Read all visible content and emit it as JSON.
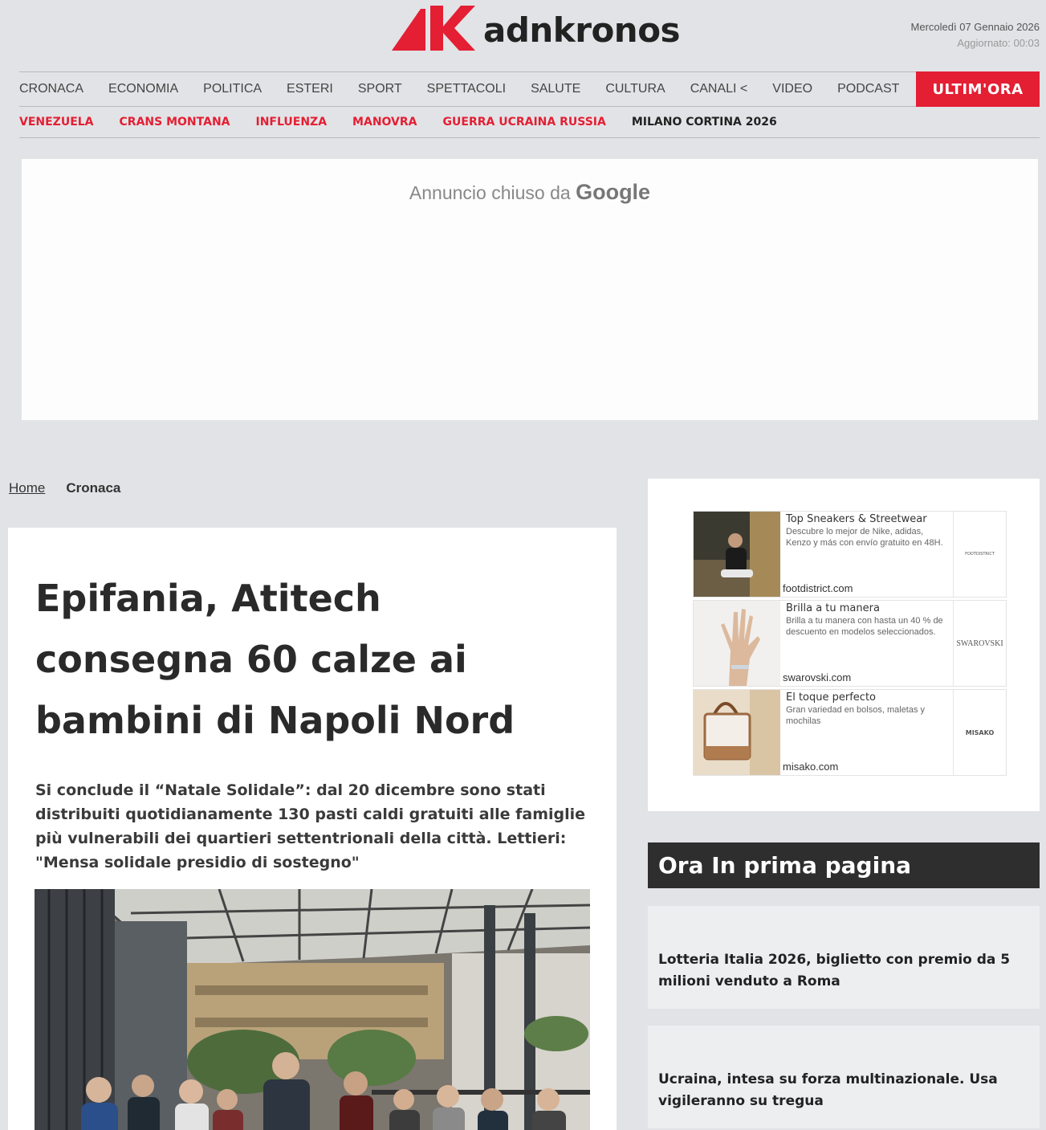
{
  "header": {
    "logo_text": "adnkronos",
    "date": "Mercoledì 07 Gennaio 2026",
    "updated": "Aggiornato: 00:03"
  },
  "nav": {
    "items": [
      "CRONACA",
      "ECONOMIA",
      "POLITICA",
      "ESTERI",
      "SPORT",
      "SPETTACOLI",
      "SALUTE",
      "CULTURA",
      "CANALI <",
      "VIDEO",
      "PODCAST"
    ],
    "ultim_ora": "ULTIM'ORA"
  },
  "topics": [
    "VENEZUELA",
    "CRANS MONTANA",
    "INFLUENZA",
    "MANOVRA",
    "GUERRA UCRAINA RUSSIA",
    "MILANO CORTINA 2026"
  ],
  "ad_top": {
    "closed_text": "Annuncio chiuso da",
    "google": "Google"
  },
  "breadcrumb": {
    "home": "Home",
    "current": "Cronaca"
  },
  "article": {
    "headline": "Epifania, Atitech consegna 60 calze ai bambini di Napoli Nord",
    "subhead": "Si conclude il “Natale Solidale”: dal 20 dicembre sono stati distribuiti quotidianamente 130 pasti caldi gratuiti alle famiglie più vulnerabili dei quartieri settentrionali della città. Lettieri: \"Mensa solidale presidio di sostegno\""
  },
  "side_ads": [
    {
      "title": "Top Sneakers & Streetwear",
      "desc": "Descubre lo mejor de Nike, adidas, Kenzo y más con envío gratuito en 48H.",
      "domain": "footdistrict.com",
      "brand": "FOOTDISTRICT"
    },
    {
      "title": "Brilla a tu manera",
      "desc": "Brilla a tu manera con hasta un 40 % de descuento en modelos seleccionados.",
      "domain": "swarovski.com",
      "brand": "SWAROVSKI"
    },
    {
      "title": "El toque perfecto",
      "desc": "Gran variedad en bolsos, maletas y mochilas",
      "domain": "misako.com",
      "brand": "MISAKO"
    }
  ],
  "prima_pagina": {
    "heading": "Ora In prima pagina",
    "items": [
      "Lotteria Italia 2026, biglietto con premio da 5 milioni venduto a Roma",
      "Ucraina, intesa su forza multinazionale. Usa vigileranno su tregua"
    ]
  }
}
